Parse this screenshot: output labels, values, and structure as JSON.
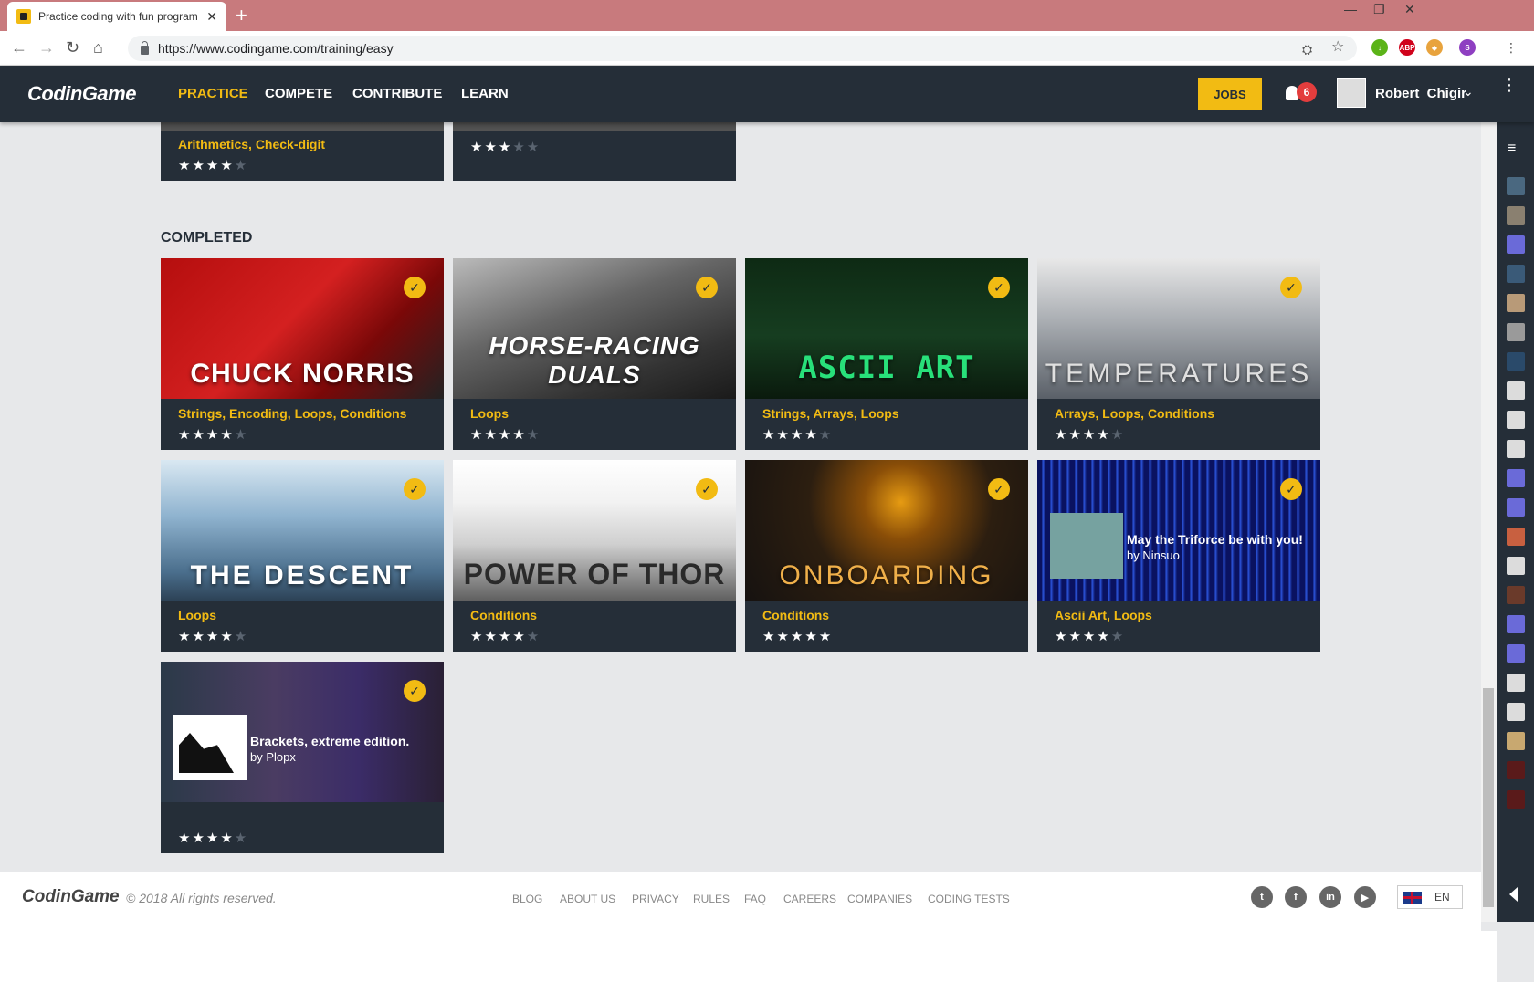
{
  "browser": {
    "tab_title": "Practice coding with fun program",
    "url": "https://www.codingame.com/training/easy",
    "new_tab_label": "+",
    "close_label": "✕"
  },
  "header": {
    "logo": "CodinGame",
    "nav": [
      "PRACTICE",
      "COMPETE",
      "CONTRIBUTE",
      "LEARN"
    ],
    "active_nav": "PRACTICE",
    "jobs_label": "JOBS",
    "notification_count": "6",
    "username": "Robert_Chigir"
  },
  "top_cards": [
    {
      "tags": [
        "Arithmetics",
        "Check-digit"
      ],
      "rating": 4
    },
    {
      "tags": [],
      "rating": 3
    }
  ],
  "section_heading": "COMPLETED",
  "cards": [
    {
      "title_art": "CHUCK NORRIS",
      "tags": [
        "Strings",
        "Encoding",
        "Loops",
        "Conditions"
      ],
      "rating": 4
    },
    {
      "title_art": "HORSE-RACING DUALS",
      "tags": [
        "Loops"
      ],
      "rating": 4
    },
    {
      "title_art": "ASCII ART",
      "tags": [
        "Strings",
        "Arrays",
        "Loops"
      ],
      "rating": 4
    },
    {
      "title_art": "TEMPERATURES",
      "tags": [
        "Arrays",
        "Loops",
        "Conditions"
      ],
      "rating": 4
    },
    {
      "title_art": "THE DESCENT",
      "tags": [
        "Loops"
      ],
      "rating": 4
    },
    {
      "title_art": "POWER OF THOR",
      "tags": [
        "Conditions"
      ],
      "rating": 4
    },
    {
      "title_art": "ONBOARDING",
      "tags": [
        "Conditions"
      ],
      "rating": 5
    },
    {
      "community_title": "May the Triforce be with you!",
      "community_author": "by Ninsuo",
      "tags": [
        "Ascii Art",
        "Loops"
      ],
      "rating": 4
    },
    {
      "community_title": "Brackets, extreme edition.",
      "community_author": "by Plopx",
      "tags": [],
      "rating": 4
    }
  ],
  "footer": {
    "logo": "CodinGame",
    "copyright": "© 2018 All rights reserved.",
    "links": [
      "BLOG",
      "ABOUT US",
      "PRIVACY",
      "RULES",
      "FAQ",
      "CAREERS",
      "COMPANIES",
      "CODING TESTS"
    ],
    "social": [
      "twitter-icon",
      "facebook-icon",
      "linkedin-icon",
      "youtube-icon"
    ],
    "language": "EN"
  },
  "colors": {
    "accent": "#f2bb13",
    "header_bg": "#252e38",
    "page_bg": "#e7e8ea"
  }
}
